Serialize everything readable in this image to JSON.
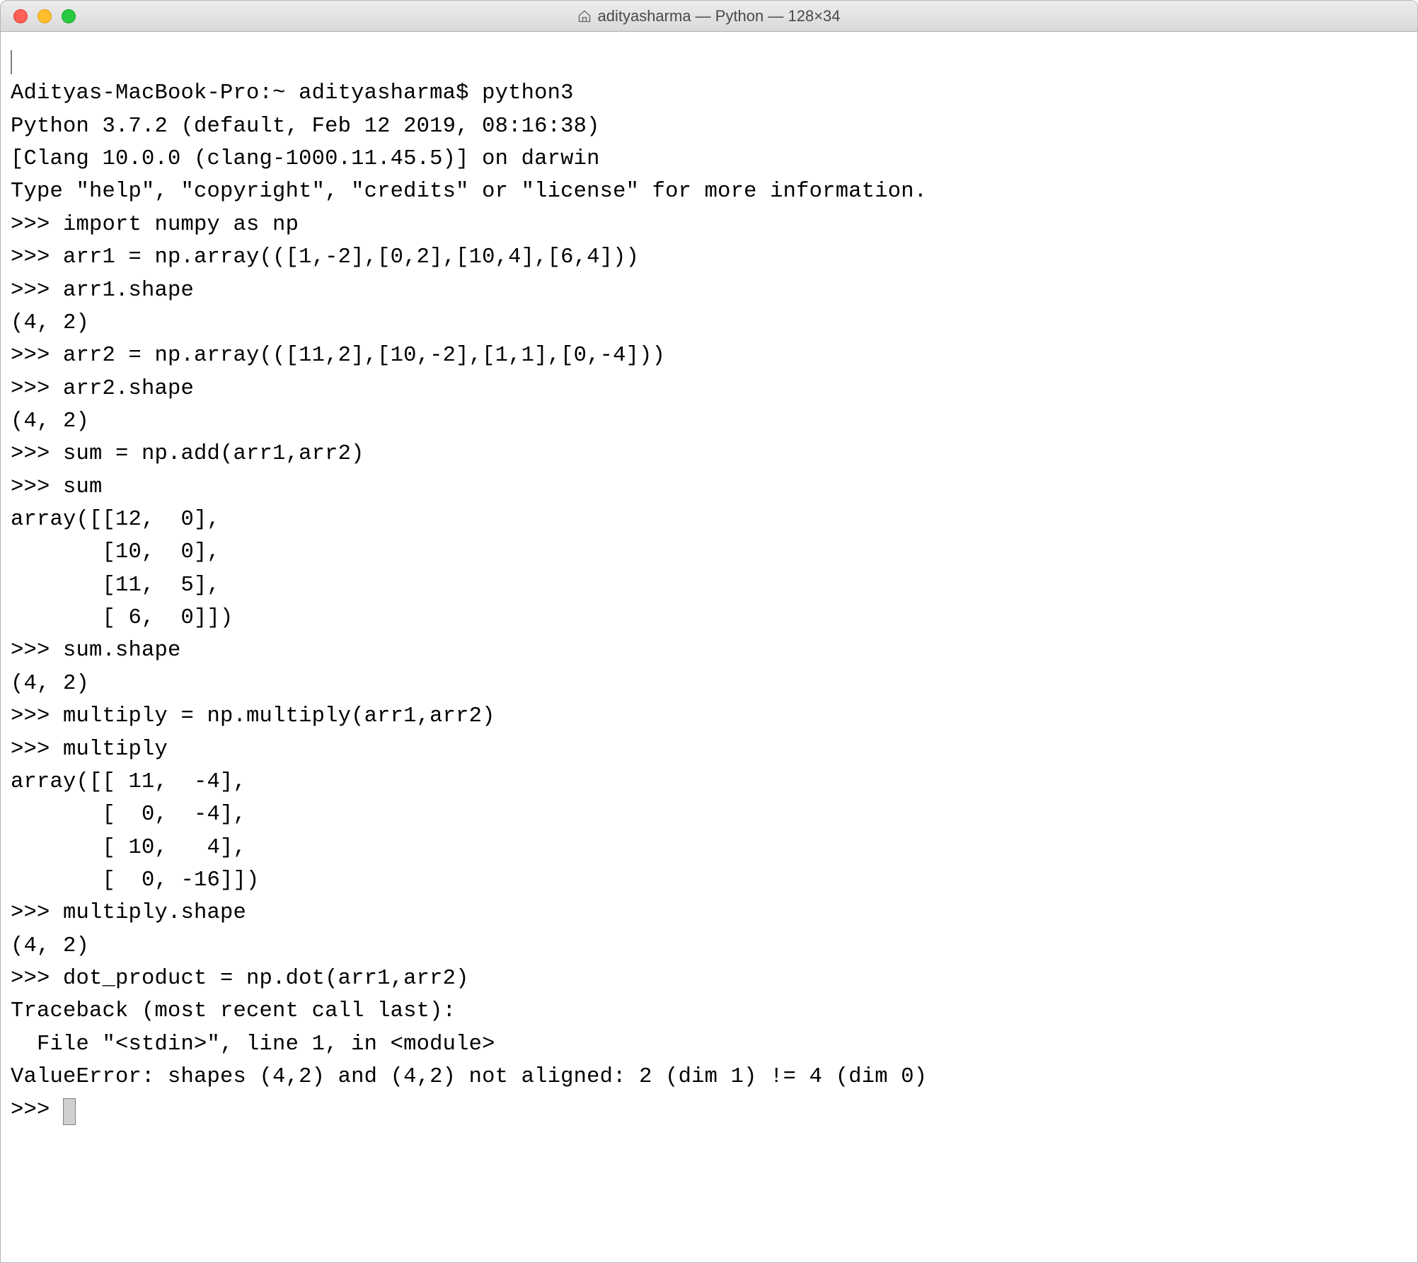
{
  "titlebar": {
    "title": "adityasharma — Python — 128×34"
  },
  "terminal": {
    "lines": [
      "",
      "Adityas-MacBook-Pro:~ adityasharma$ python3",
      "Python 3.7.2 (default, Feb 12 2019, 08:16:38)",
      "[Clang 10.0.0 (clang-1000.11.45.5)] on darwin",
      "Type \"help\", \"copyright\", \"credits\" or \"license\" for more information.",
      ">>> import numpy as np",
      ">>> arr1 = np.array(([1,-2],[0,2],[10,4],[6,4]))",
      ">>> arr1.shape",
      "(4, 2)",
      ">>> arr2 = np.array(([11,2],[10,-2],[1,1],[0,-4]))",
      ">>> arr2.shape",
      "(4, 2)",
      ">>> sum = np.add(arr1,arr2)",
      ">>> sum",
      "array([[12,  0],",
      "       [10,  0],",
      "       [11,  5],",
      "       [ 6,  0]])",
      ">>> sum.shape",
      "(4, 2)",
      ">>> multiply = np.multiply(arr1,arr2)",
      ">>> multiply",
      "array([[ 11,  -4],",
      "       [  0,  -4],",
      "       [ 10,   4],",
      "       [  0, -16]])",
      ">>> multiply.shape",
      "(4, 2)",
      ">>> dot_product = np.dot(arr1,arr2)",
      "Traceback (most recent call last):",
      "  File \"<stdin>\", line 1, in <module>",
      "ValueError: shapes (4,2) and (4,2) not aligned: 2 (dim 1) != 4 (dim 0)",
      ">>> "
    ]
  }
}
